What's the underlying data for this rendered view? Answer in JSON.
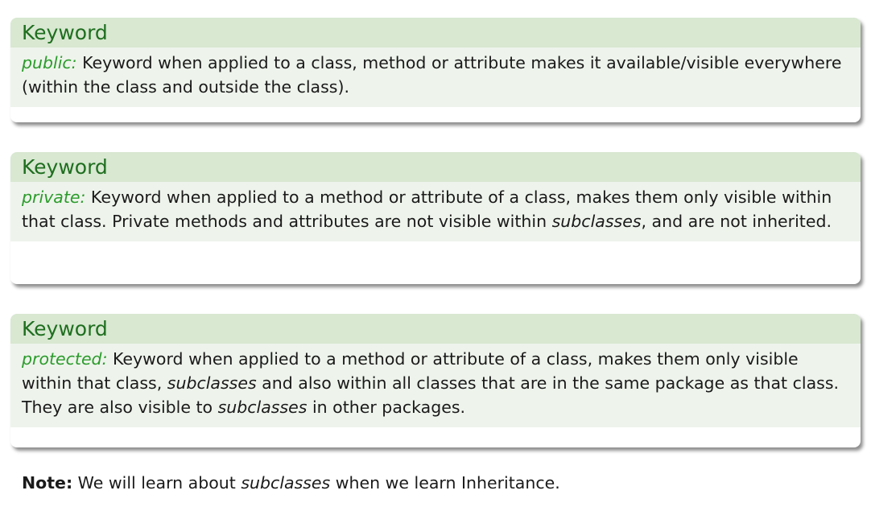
{
  "blocks": [
    {
      "title": "Keyword",
      "keyword": "public:",
      "text": " Keyword when applied to a class, method or attribute makes it available/visible everywhere (within the class and outside the class)."
    },
    {
      "title": "Keyword",
      "keyword": "private:",
      "text_a": " Keyword when applied to a method or attribute of a class, makes them only visible within that class. Private methods and attributes are not visible within ",
      "em_1": "subclasses",
      "text_b": ", and are not inherited."
    },
    {
      "title": "Keyword",
      "keyword": "protected:",
      "text_a": " Keyword when applied to a method or attribute of a class, makes them only visible within that class, ",
      "em_1": "subclasses",
      "text_b": " and also within all classes that are in the same package as that class. They are also visible to ",
      "em_2": "subclasses",
      "text_c": " in other packages."
    }
  ],
  "note": {
    "label": "Note:",
    "text_a": " We will learn about ",
    "em": "subclasses",
    "text_b": " when we learn Inheritance."
  },
  "colors": {
    "title_text": "#1f6e1f",
    "title_bg": "#d8e8d1",
    "body_bg": "#eef4ec",
    "keyword": "#2b9b2b"
  }
}
